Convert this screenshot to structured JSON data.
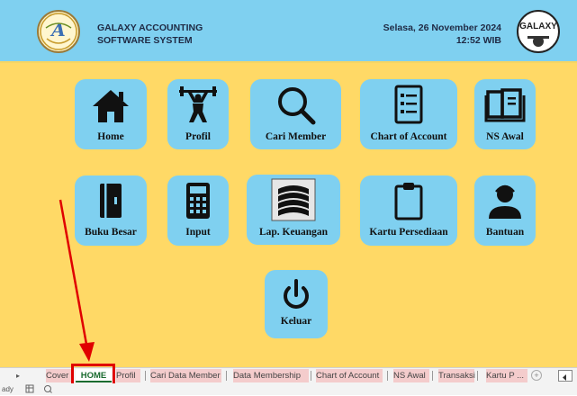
{
  "header": {
    "brand_line1": "GALAXY ACCOUNTING",
    "brand_line2": "SOFTWARE SYSTEM",
    "date": "Selasa, 26 November 2024",
    "time": "12:52 WIB",
    "right_logo_text": "GALAXY",
    "colors": {
      "header_bg": "#7fd0f0",
      "main_bg": "#ffd966",
      "tile_bg": "#7fd0f0"
    }
  },
  "tiles": [
    {
      "label": "Home",
      "icon": "home-icon"
    },
    {
      "label": "Profil",
      "icon": "weightlifter-icon"
    },
    {
      "label": "Cari Member",
      "icon": "magnifier-icon"
    },
    {
      "label": "Chart of Account",
      "icon": "list-document-icon"
    },
    {
      "label": "NS Awal",
      "icon": "open-book-icon"
    },
    {
      "label": "Buku Besar",
      "icon": "ledger-book-icon"
    },
    {
      "label": "Input",
      "icon": "calculator-icon"
    },
    {
      "label": "Lap. Keuangan",
      "icon": "book-stack-icon"
    },
    {
      "label": "Kartu Persediaan",
      "icon": "clipboard-icon"
    },
    {
      "label": "Bantuan",
      "icon": "support-agent-icon"
    },
    {
      "label": "Keluar",
      "icon": "power-icon"
    }
  ],
  "sheet_tabs": {
    "items": [
      "Cover",
      "HOME",
      "Profil",
      "Cari Data Member",
      "Data Membership",
      "Chart of Account",
      "NS Awal",
      "Transaksi",
      "Kartu P ..."
    ],
    "active": "HOME",
    "add_label": "+"
  },
  "statusbar": {
    "ready": "ady"
  }
}
